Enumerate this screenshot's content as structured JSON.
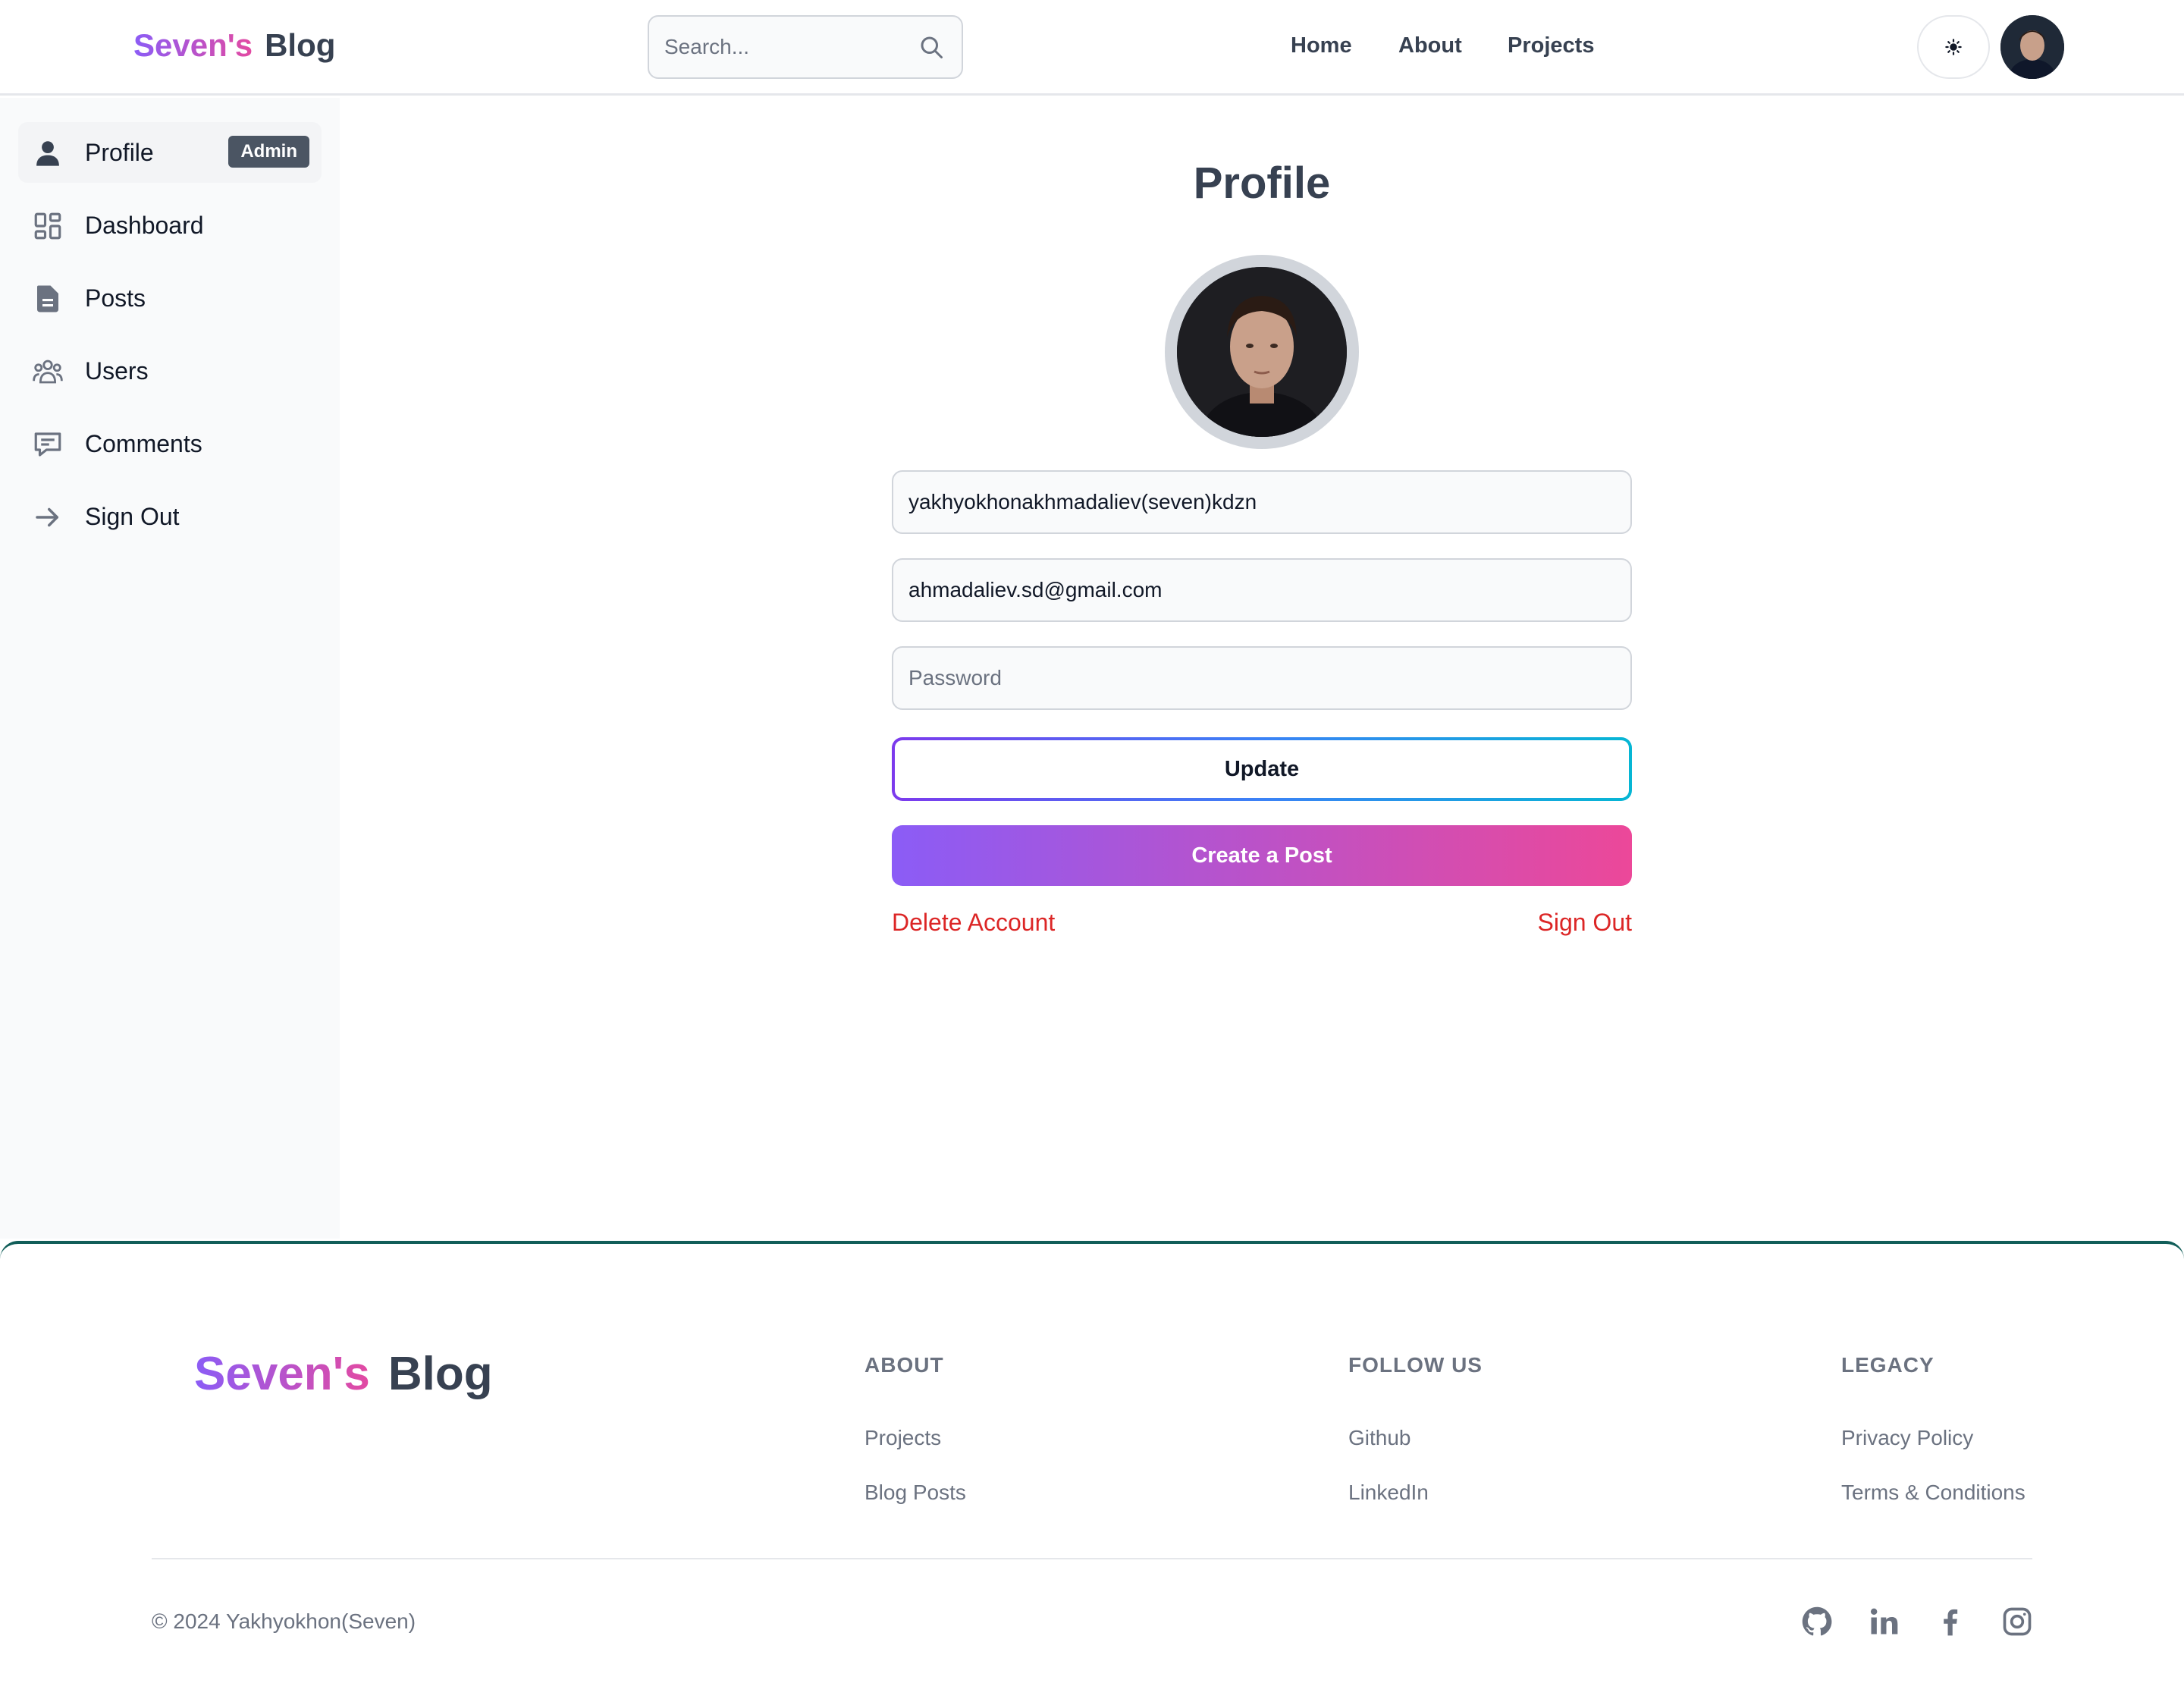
{
  "header": {
    "logo_part1": "Seven's",
    "logo_part2": "Blog",
    "search_placeholder": "Search...",
    "nav": [
      "Home",
      "About",
      "Projects"
    ],
    "theme_icon": "sun-icon"
  },
  "sidebar": {
    "items": [
      {
        "label": "Profile",
        "icon": "user-icon",
        "badge": "Admin",
        "active": true
      },
      {
        "label": "Dashboard",
        "icon": "dashboard-grid-icon"
      },
      {
        "label": "Posts",
        "icon": "document-icon"
      },
      {
        "label": "Users",
        "icon": "users-group-icon"
      },
      {
        "label": "Comments",
        "icon": "chat-icon"
      },
      {
        "label": "Sign Out",
        "icon": "arrow-right-icon"
      }
    ]
  },
  "profile": {
    "title": "Profile",
    "username_value": "yakhyokhonakhmadaliev(seven)kdzn",
    "email_value": "ahmadaliev.sd@gmail.com",
    "password_placeholder": "Password",
    "update_label": "Update",
    "create_post_label": "Create a Post",
    "delete_account_label": "Delete Account",
    "sign_out_label": "Sign Out"
  },
  "footer": {
    "logo_part1": "Seven's",
    "logo_part2": "Blog",
    "columns": [
      {
        "heading": "ABOUT",
        "links": [
          "Projects",
          "Blog Posts"
        ]
      },
      {
        "heading": "FOLLOW US",
        "links": [
          "Github",
          "LinkedIn"
        ]
      },
      {
        "heading": "LEGACY",
        "links": [
          "Privacy Policy",
          "Terms & Conditions"
        ]
      }
    ],
    "copyright": "© 2024 Yakhyokhon(Seven)",
    "social_icons": [
      "github-icon",
      "linkedin-icon",
      "facebook-icon",
      "instagram-icon"
    ]
  },
  "colors": {
    "gradient_start": "#8b5cf6",
    "gradient_end": "#ec4899",
    "danger": "#dc2626",
    "footer_border": "#115e59"
  }
}
